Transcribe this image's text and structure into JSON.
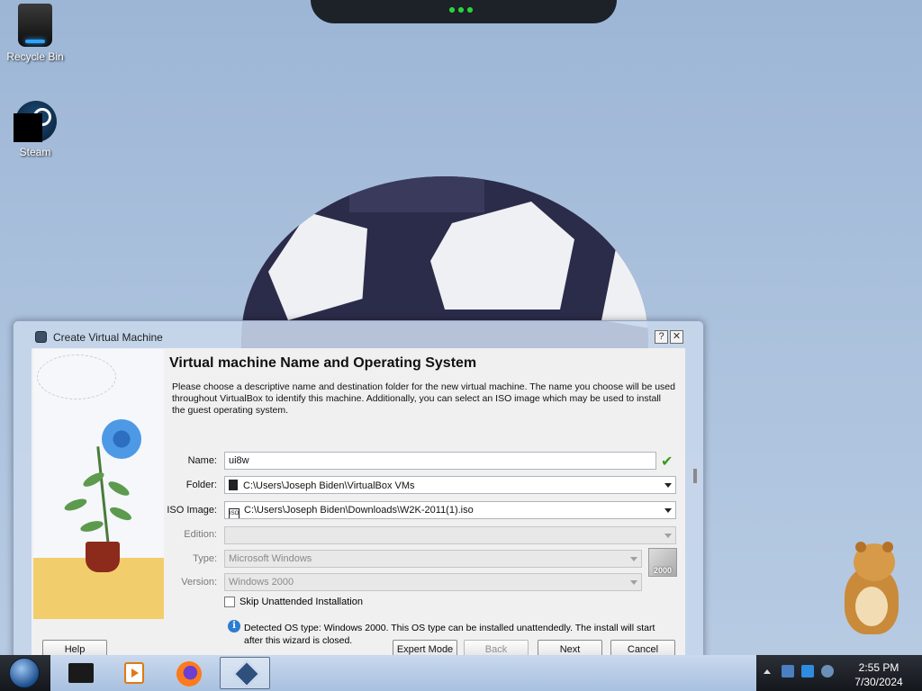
{
  "desktop": {
    "icons": [
      {
        "label": "Recycle Bin",
        "icon": "recycle-bin-icon"
      },
      {
        "label": "Steam",
        "icon": "steam-icon"
      }
    ]
  },
  "dialog": {
    "title": "Create Virtual Machine",
    "help_glyph": "?",
    "close_glyph": "✕",
    "heading": "Virtual machine Name and Operating System",
    "description": "Please choose a descriptive name and destination folder for the new virtual machine. The name you choose will be used throughout VirtualBox to identify this machine. Additionally, you can select an ISO image which may be used to install the guest operating system.",
    "fields": {
      "name_label": "Name:",
      "name_value": "ui8w",
      "folder_label": "Folder:",
      "folder_value": "C:\\Users\\Joseph Biden\\VirtualBox VMs",
      "iso_label": "ISO Image:",
      "iso_value": "C:\\Users\\Joseph Biden\\Downloads\\W2K-2011(1).iso",
      "edition_label": "Edition:",
      "edition_value": "",
      "type_label": "Type:",
      "type_value": "Microsoft Windows",
      "version_label": "Version:",
      "version_value": "Windows 2000"
    },
    "os_badge": "2000",
    "skip_unattended_label": "Skip Unattended Installation",
    "skip_unattended_checked": false,
    "info_text": "Detected OS type: Windows 2000. This OS type can be installed unattendedly. The install will start after this wizard is closed.",
    "buttons": {
      "help": "Help",
      "expert": "Expert Mode",
      "back": "Back",
      "next": "Next",
      "cancel": "Cancel"
    }
  },
  "taskbar": {
    "items": [
      "terminal-icon",
      "media-player-icon",
      "firefox-icon",
      "virtualbox-icon"
    ],
    "active_item": "virtualbox-icon",
    "clock_time": "2:55 PM",
    "clock_date": "7/30/2024"
  },
  "colors": {
    "accent": "#2b7cd3",
    "check": "#3a9c1c"
  }
}
